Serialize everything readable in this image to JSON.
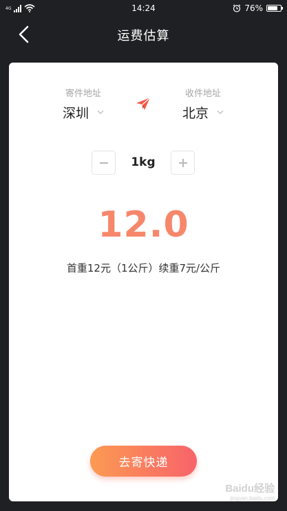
{
  "status_bar": {
    "network": "4G",
    "time": "14:24",
    "battery": "76%",
    "battery_level": 0.76
  },
  "nav": {
    "title": "运费估算"
  },
  "form": {
    "from_label": "寄件地址",
    "from_city": "深圳",
    "to_label": "收件地址",
    "to_city": "北京",
    "weight": "1kg",
    "price": "12.0",
    "rate_note": "首重12元（1公斤）续重7元/公斤",
    "send_button": "去寄快递"
  },
  "watermark": {
    "brand": "Baidu经验",
    "url": "jingyan.baidu.com"
  },
  "colors": {
    "background": "#1f2023",
    "accent": "#f7876b",
    "plane": "#f25a48",
    "button_start": "#fb9a52",
    "button_end": "#f8636a"
  },
  "icons": [
    "back-icon",
    "chevron-down-icon",
    "paper-plane-icon",
    "minus-icon",
    "plus-icon",
    "wifi-icon",
    "alarm-icon",
    "battery-icon"
  ]
}
